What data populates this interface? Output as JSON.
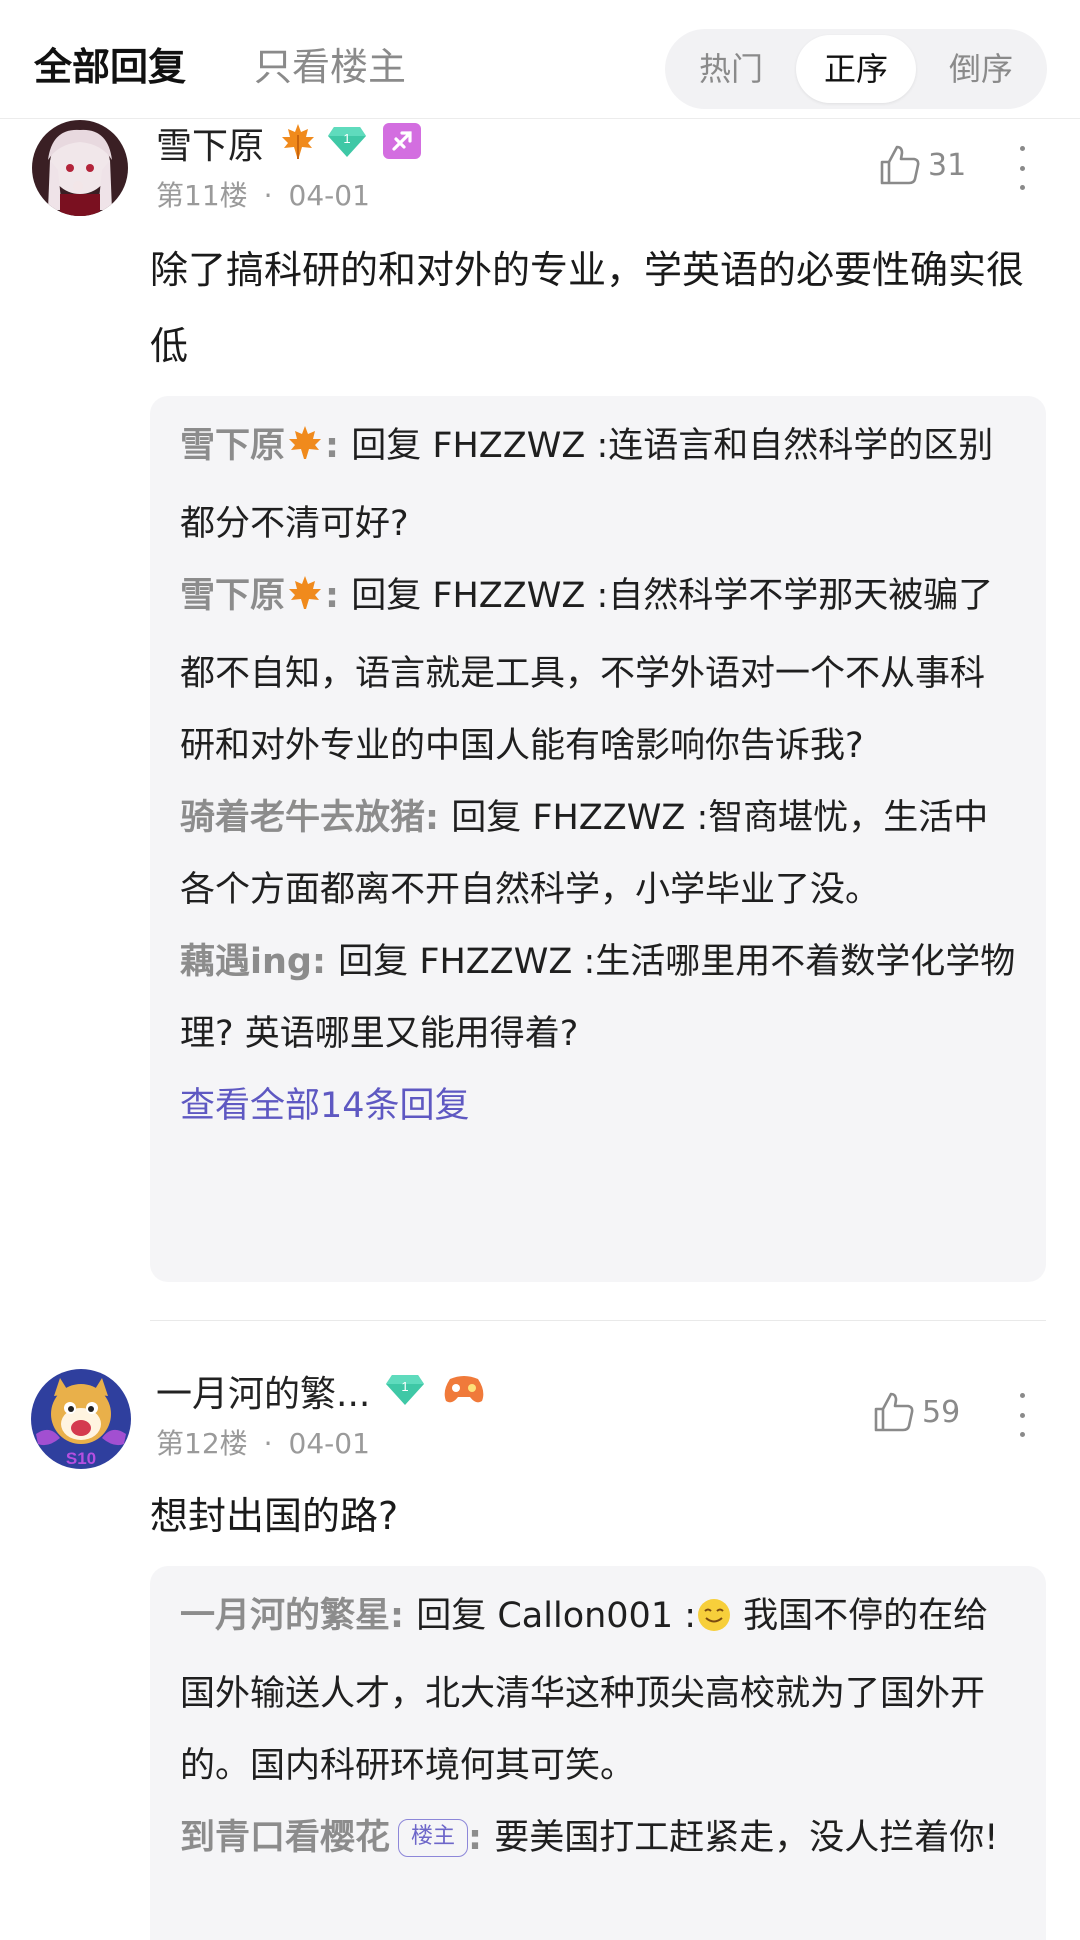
{
  "header": {
    "tab_all": "全部回复",
    "tab_op_only": "只看楼主",
    "sort_hot": "热门",
    "sort_asc": "正序",
    "sort_desc": "倒序",
    "sort_selected": "正序"
  },
  "comments": [
    {
      "username": "雪下原",
      "level": "1",
      "floor": "第11楼",
      "date": "04-01",
      "likes": "31",
      "text": "除了搞科研的和对外的专业，学英语的必要性确实很低",
      "replies": [
        {
          "name": "雪下原",
          "reply_prefix": "回复",
          "target": "FHZZWZ",
          "content": ":连语言和自然科学的区别都分不清可好?"
        },
        {
          "name": "雪下原",
          "reply_prefix": "回复",
          "target": "FHZZWZ",
          "content": ":自然科学不学那天被骗了都不自知，语言就是工具，不学外语对一个不从事科研和对外专业的中国人能有啥影响你告诉我?"
        },
        {
          "name": "骑着老牛去放猪",
          "reply_prefix": "回复",
          "target": "FHZZWZ",
          "content": ":智商堪忧，生活中各个方面都离不开自然科学，小学毕业了没。"
        },
        {
          "name": "藕遇ing",
          "reply_prefix": "回复",
          "target": "FHZZWZ",
          "content": ":生活哪里用不着数学化学物理? 英语哪里又能用得着?"
        }
      ],
      "view_all": "查看全部14条回复"
    },
    {
      "username": "一月河的繁...",
      "level": "1",
      "avatar_badge": "S10",
      "floor": "第12楼",
      "date": "04-01",
      "likes": "59",
      "text": "想封出国的路?",
      "replies": [
        {
          "name": "一月河的繁星",
          "reply_prefix": "回复",
          "target": "Callon001",
          "content": "我国不停的在给国外输送人才，北大清华这种顶尖高校就为了国外开的。国内科研环境何其可笑。"
        },
        {
          "name": "到青口看樱花",
          "op_tag": "楼主",
          "content": "要美国打工赶紧走，没人拦着你!"
        }
      ]
    }
  ],
  "colors": {
    "accent": "#5e58c2",
    "muted_name": "#8c8c8c",
    "reply_bg": "#f5f5f7"
  }
}
